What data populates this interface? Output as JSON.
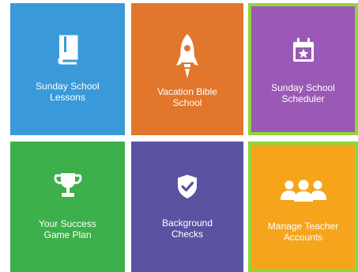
{
  "tiles": [
    {
      "label": "Sunday School\nLessons",
      "icon": "book-icon",
      "color": "#3a9ad9"
    },
    {
      "label": "Vacation Bible\nSchool",
      "icon": "rocket-icon",
      "color": "#e2762c"
    },
    {
      "label": "Sunday School\nScheduler",
      "icon": "calendar-star-icon",
      "color": "#9b59b6",
      "highlighted": true
    },
    {
      "label": "Your Success\nGame Plan",
      "icon": "trophy-icon",
      "color": "#3daf4b"
    },
    {
      "label": "Background\nChecks",
      "icon": "shield-check-icon",
      "color": "#5a53a1"
    },
    {
      "label": "Manage Teacher\nAccounts",
      "icon": "users-icon",
      "color": "#f6a41c",
      "highlighted": true
    }
  ],
  "colors": {
    "highlight_border": "#8fd63a"
  }
}
